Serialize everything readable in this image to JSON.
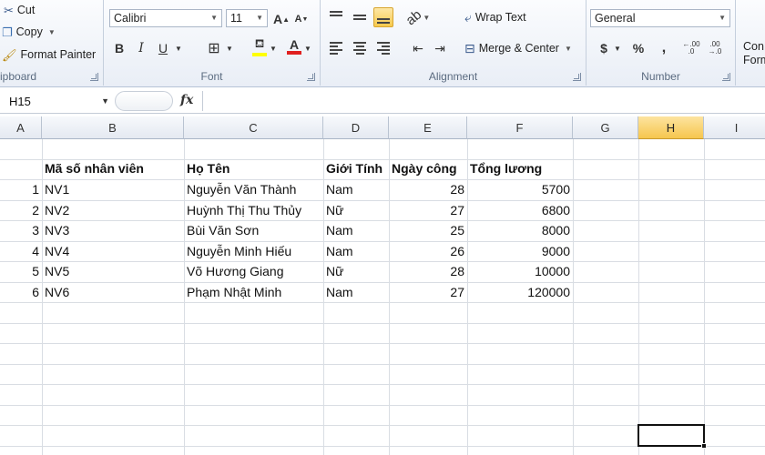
{
  "ribbon": {
    "clipboard": {
      "label": "ipboard",
      "cut": "Cut",
      "copy": "Copy",
      "format_painter": "Format Painter"
    },
    "font": {
      "label": "Font",
      "font_name": "Calibri",
      "font_size": "11",
      "bold": "B",
      "italic": "I",
      "underline": "U",
      "font_color_letter": "A",
      "grow_font": "A",
      "shrink_font": "A"
    },
    "alignment": {
      "label": "Alignment",
      "wrap_text": "Wrap Text",
      "merge_center": "Merge & Center"
    },
    "number": {
      "label": "Number",
      "format": "General",
      "currency": "$",
      "percent": "%",
      "comma": ",",
      "increase_decimal": ".00",
      "decrease_decimal": ".00"
    },
    "styles": {
      "conditional_top": "Con",
      "conditional_bottom": "Form"
    },
    "colors": {
      "highlight": "#ffff00",
      "font_color": "#e02020"
    }
  },
  "formula_bar": {
    "name_box": "H15",
    "fx": "fx",
    "value": ""
  },
  "columns": [
    "A",
    "B",
    "C",
    "D",
    "E",
    "F",
    "G",
    "H",
    "I"
  ],
  "selected_column": "H",
  "table": {
    "headers": [
      "Mã số nhân viên",
      "Họ Tên",
      "Giới Tính",
      "Ngày công",
      "Tổng lương"
    ],
    "rows": [
      {
        "stt": "1",
        "ma": "NV1",
        "ten": "Nguyễn Văn Thành",
        "gt": "Nam",
        "cong": "28",
        "luong": "5700"
      },
      {
        "stt": "2",
        "ma": "NV2",
        "ten": "Huỳnh Thị Thu Thủy",
        "gt": "Nữ",
        "cong": "27",
        "luong": "6800"
      },
      {
        "stt": "3",
        "ma": "NV3",
        "ten": "Bùi Văn Sơn",
        "gt": "Nam",
        "cong": "25",
        "luong": "8000"
      },
      {
        "stt": "4",
        "ma": "NV4",
        "ten": "Nguyễn Minh Hiếu",
        "gt": "Nam",
        "cong": "26",
        "luong": "9000"
      },
      {
        "stt": "5",
        "ma": "NV5",
        "ten": "Võ Hương Giang",
        "gt": "Nữ",
        "cong": "28",
        "luong": "10000"
      },
      {
        "stt": "6",
        "ma": "NV6",
        "ten": "Phạm Nhật Minh",
        "gt": "Nam",
        "cong": "27",
        "luong": "120000"
      }
    ]
  }
}
